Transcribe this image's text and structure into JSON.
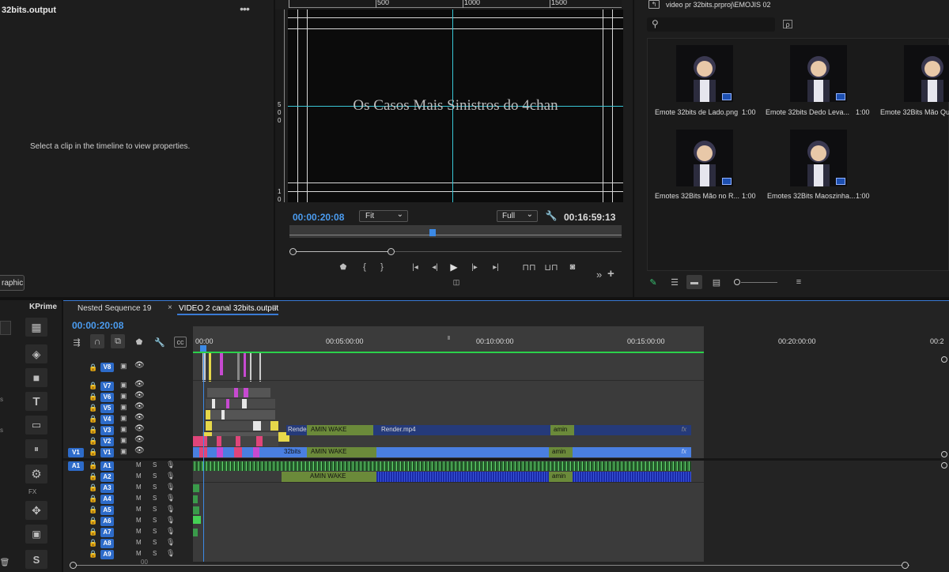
{
  "left_panel": {
    "title": "32bits.output",
    "menu_icon": "more-dots-icon",
    "empty_message": "Select a clip in the timeline to view properties.",
    "tab_label": "raphic"
  },
  "monitor": {
    "ruler_labels": [
      "500",
      "1000",
      "1500"
    ],
    "left_ruler_labels": [
      "5",
      "0",
      "0",
      "1",
      "0",
      "0"
    ],
    "overlay_title": "Os Casos Mais Sinistros do 4chan",
    "timecode": "00:00:20:08",
    "fit_label": "Fit",
    "quality_label": "Full",
    "duration": "00:16:59:13",
    "controls": [
      "add-marker-icon",
      "mark-in-icon",
      "mark-out-icon",
      "go-to-in-icon",
      "step-back-icon",
      "play-icon",
      "step-forward-icon",
      "go-to-out-icon",
      "insert-icon",
      "overwrite-icon",
      "export-frame-icon"
    ],
    "extra": "»",
    "add": "+",
    "compare_icon": "compare-icon"
  },
  "project": {
    "path": "video pr 32bits.prproj\\EMOJIS 02",
    "search_placeholder": "",
    "items": [
      {
        "name": "Emote 32bits de Lado.png",
        "duration": "1:00"
      },
      {
        "name": "Emote 32bits Dedo Leva...",
        "duration": "1:00"
      },
      {
        "name": "Emote 32Bits Mão Qu",
        "duration": ""
      },
      {
        "name": "Emotes 32Bits Mão no R...",
        "duration": "1:00"
      },
      {
        "name": "Emotes 32Bits Maoszinha...",
        "duration": "1:00"
      }
    ],
    "bottom_icons": [
      "pencil-icon",
      "list-view-icon",
      "icon-view-icon",
      "freeform-view-icon",
      "zoom-slider-icon",
      "sort-icon"
    ]
  },
  "tools": {
    "panel_label": "KPrime",
    "fx_label": "FX",
    "items": [
      "film-icon",
      "layers-icon",
      "square-icon",
      "type-tool-icon",
      "folder-icon",
      "pause-icon",
      "gear-icon",
      "move-icon",
      "box-icon",
      "s-icon"
    ]
  },
  "timeline": {
    "tabs": [
      {
        "label": "Nested Sequence 19"
      },
      {
        "label": "VIDEO 2 canal 32bits.output"
      }
    ],
    "timecode": "00:00:20:08",
    "ruler": [
      "00:00",
      "00:05:00:00",
      "00:10:00:00",
      "00:15:00:00",
      "00:20:00:00",
      "00:2"
    ],
    "video_tracks": [
      "V8",
      "V7",
      "V6",
      "V5",
      "V4",
      "V3",
      "V2",
      "V1"
    ],
    "audio_tracks": [
      "A1",
      "A2",
      "A3",
      "A4",
      "A5",
      "A6",
      "A7",
      "A8",
      "A9"
    ],
    "source_v": "V1",
    "source_a": "A1",
    "mute": "M",
    "solo": "S",
    "clips": {
      "v3_a": "Rende",
      "v3_b": "AMIN WAKE",
      "v3_c": "Render.mp4",
      "v3_d": "amin",
      "v1_a": "32bits",
      "v1_b": "AMIN WAKE",
      "v1_c": "amin",
      "a2_a": "AMIN WAKE",
      "a2_b": "amin",
      "fx": "fx"
    },
    "scroll_value": "00"
  }
}
